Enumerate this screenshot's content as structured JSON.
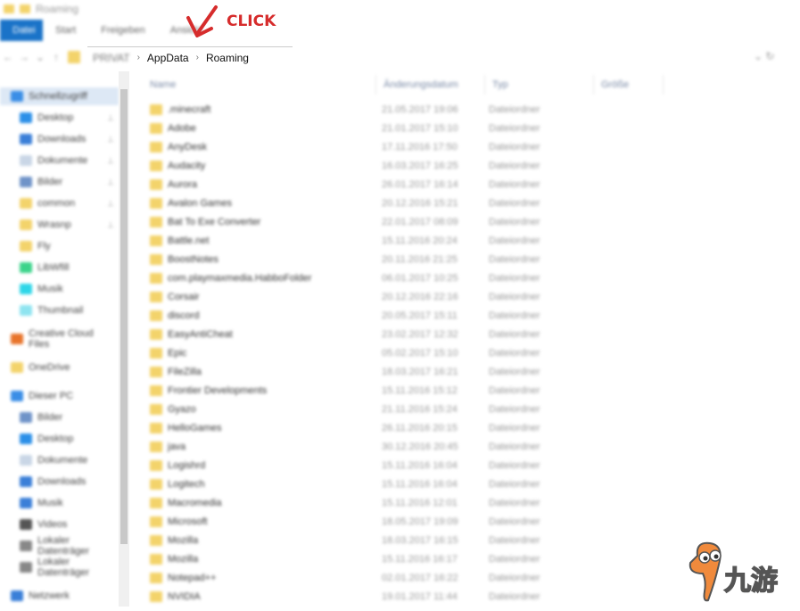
{
  "window": {
    "title": "Roaming"
  },
  "ribbon": {
    "tabs": [
      "Datei",
      "Start",
      "Freigeben",
      "Ansicht"
    ]
  },
  "annotation": {
    "label": "CLICK",
    "color": "#d62c2c"
  },
  "address": {
    "crumbs": [
      "PRIVAT",
      "AppData",
      "Roaming"
    ]
  },
  "columns": [
    "Name",
    "Änderungsdatum",
    "Typ",
    "Größe"
  ],
  "sidebar": [
    {
      "label": "Schnellzugriff",
      "color": "#3a8ee6"
    },
    {
      "label": "Desktop",
      "color": "#2b8fe8"
    },
    {
      "label": "Downloads",
      "color": "#3a7fd8"
    },
    {
      "label": "Dokumente",
      "color": "#c9d6e6"
    },
    {
      "label": "Bilder",
      "color": "#6f93c8"
    },
    {
      "label": "common",
      "color": "#f3d36b"
    },
    {
      "label": "Wrasnp",
      "color": "#f3d36b"
    },
    {
      "label": "Fly",
      "color": "#f3d36b"
    },
    {
      "label": "LibWfill",
      "color": "#3bd38a"
    },
    {
      "label": "Musik",
      "color": "#2ed6e8"
    },
    {
      "label": "Thumbnail",
      "color": "#8ee4f0"
    },
    {
      "label": "Creative Cloud Files",
      "color": "#e8742b"
    },
    {
      "label": "OneDrive",
      "color": "#f3d36b"
    },
    {
      "label": "Dieser PC",
      "color": "#3a8ee6"
    },
    {
      "label": "Bilder",
      "color": "#6f93c8"
    },
    {
      "label": "Desktop",
      "color": "#2b8fe8"
    },
    {
      "label": "Dokumente",
      "color": "#c9d6e6"
    },
    {
      "label": "Downloads",
      "color": "#3a7fd8"
    },
    {
      "label": "Musik",
      "color": "#3a7fd8"
    },
    {
      "label": "Videos",
      "color": "#555555"
    },
    {
      "label": "Lokaler Datenträger",
      "color": "#888888"
    },
    {
      "label": "Lokaler Datenträger",
      "color": "#888888"
    },
    {
      "label": "Netzwerk",
      "color": "#3a7fd8"
    }
  ],
  "files": [
    {
      "name": ".minecraft",
      "date": "21.05.2017 19:06",
      "type": "Dateiordner"
    },
    {
      "name": "Adobe",
      "date": "21.01.2017 15:10",
      "type": "Dateiordner"
    },
    {
      "name": "AnyDesk",
      "date": "17.11.2016 17:50",
      "type": "Dateiordner"
    },
    {
      "name": "Audacity",
      "date": "16.03.2017 16:25",
      "type": "Dateiordner"
    },
    {
      "name": "Aurora",
      "date": "26.01.2017 16:14",
      "type": "Dateiordner"
    },
    {
      "name": "Avalon Games",
      "date": "20.12.2016 15:21",
      "type": "Dateiordner"
    },
    {
      "name": "Bat To Exe Converter",
      "date": "22.01.2017 08:09",
      "type": "Dateiordner"
    },
    {
      "name": "Battle.net",
      "date": "15.11.2016 20:24",
      "type": "Dateiordner"
    },
    {
      "name": "BoostNotes",
      "date": "20.11.2016 21:25",
      "type": "Dateiordner"
    },
    {
      "name": "com.playmaxmedia.HabboFolder",
      "date": "06.01.2017 10:25",
      "type": "Dateiordner"
    },
    {
      "name": "Corsair",
      "date": "20.12.2016 22:16",
      "type": "Dateiordner"
    },
    {
      "name": "discord",
      "date": "20.05.2017 15:11",
      "type": "Dateiordner"
    },
    {
      "name": "EasyAntiCheat",
      "date": "23.02.2017 12:32",
      "type": "Dateiordner"
    },
    {
      "name": "Epic",
      "date": "05.02.2017 15:10",
      "type": "Dateiordner"
    },
    {
      "name": "FileZilla",
      "date": "18.03.2017 16:21",
      "type": "Dateiordner"
    },
    {
      "name": "Frontier Developments",
      "date": "15.11.2016 15:12",
      "type": "Dateiordner"
    },
    {
      "name": "Gyazo",
      "date": "21.11.2016 15:24",
      "type": "Dateiordner"
    },
    {
      "name": "HelloGames",
      "date": "26.11.2016 20:15",
      "type": "Dateiordner"
    },
    {
      "name": "java",
      "date": "30.12.2016 20:45",
      "type": "Dateiordner"
    },
    {
      "name": "Logishrd",
      "date": "15.11.2016 16:04",
      "type": "Dateiordner"
    },
    {
      "name": "Logitech",
      "date": "15.11.2016 16:04",
      "type": "Dateiordner"
    },
    {
      "name": "Macromedia",
      "date": "15.11.2016 12:01",
      "type": "Dateiordner"
    },
    {
      "name": "Microsoft",
      "date": "18.05.2017 19:09",
      "type": "Dateiordner"
    },
    {
      "name": "Mozilla",
      "date": "18.03.2017 16:15",
      "type": "Dateiordner"
    },
    {
      "name": "Mozilla",
      "date": "15.11.2016 16:17",
      "type": "Dateiordner"
    },
    {
      "name": "Notepad++",
      "date": "02.01.2017 16:22",
      "type": "Dateiordner"
    },
    {
      "name": "NVIDIA",
      "date": "19.01.2017 11:44",
      "type": "Dateiordner"
    }
  ],
  "watermark": {
    "text": "九游"
  }
}
